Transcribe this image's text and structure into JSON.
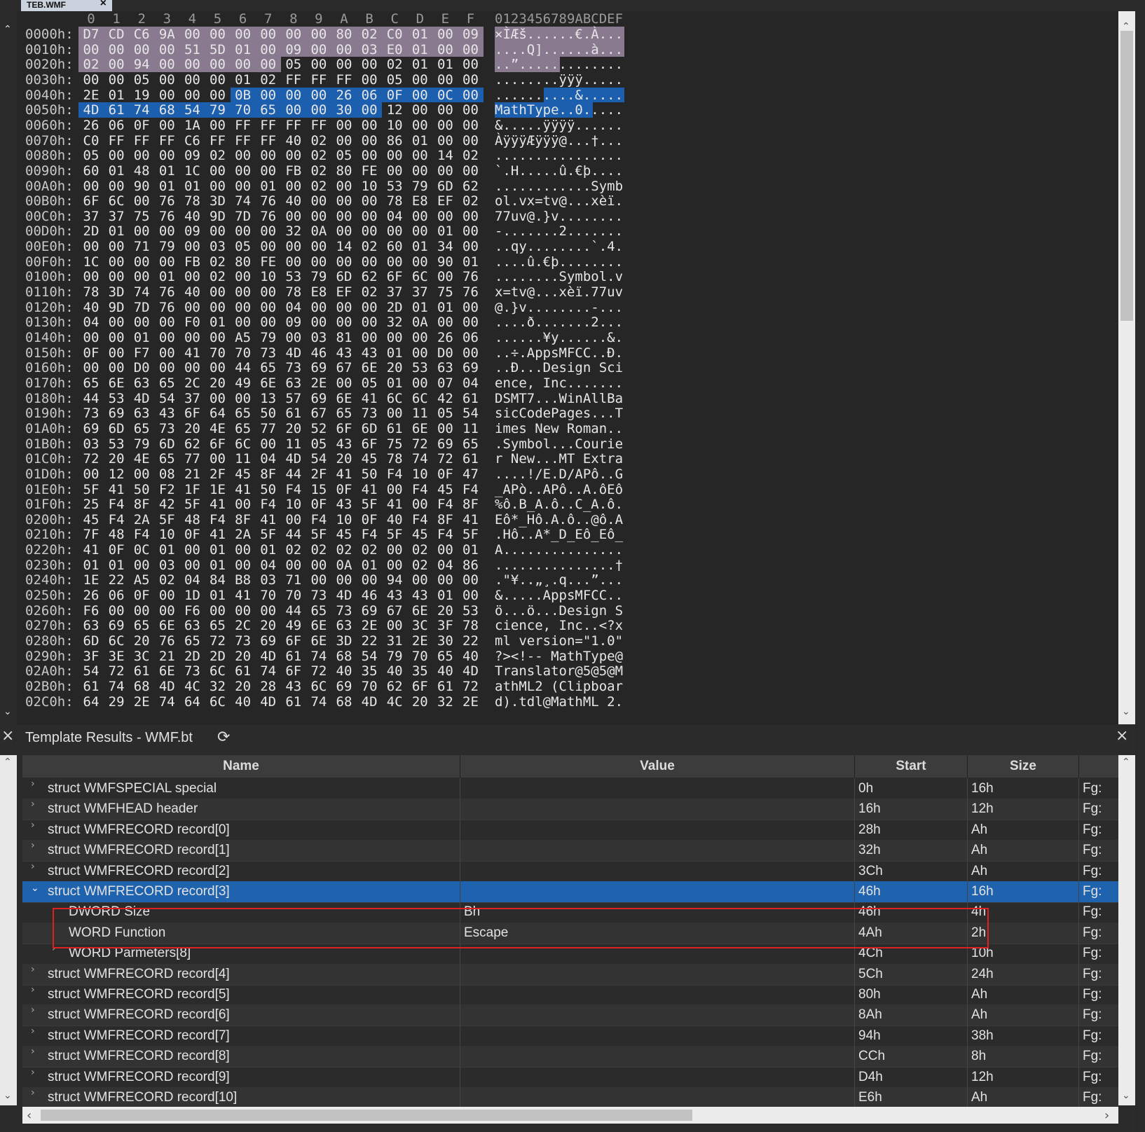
{
  "tab": {
    "title": "TEB.WMF",
    "close": "×"
  },
  "hex_header": {
    "cols": [
      "0",
      "1",
      "2",
      "3",
      "4",
      "5",
      "6",
      "7",
      "8",
      "9",
      "A",
      "B",
      "C",
      "D",
      "E",
      "F"
    ],
    "ascii": "0123456789ABCDEF"
  },
  "hex_rows": [
    {
      "addr": "0000h:",
      "bytes": [
        "D7",
        "CD",
        "C6",
        "9A",
        "00",
        "00",
        "00",
        "00",
        "00",
        "00",
        "80",
        "02",
        "C0",
        "01",
        "00",
        "09"
      ],
      "ascii": "×ÌÆš......€.À..."
    },
    {
      "addr": "0010h:",
      "bytes": [
        "00",
        "00",
        "00",
        "00",
        "51",
        "5D",
        "01",
        "00",
        "09",
        "00",
        "00",
        "03",
        "E0",
        "01",
        "00",
        "00"
      ],
      "ascii": "....Q]......à..."
    },
    {
      "addr": "0020h:",
      "bytes": [
        "02",
        "00",
        "94",
        "00",
        "00",
        "00",
        "00",
        "00",
        "05",
        "00",
        "00",
        "00",
        "02",
        "01",
        "01",
        "00"
      ],
      "ascii": "..”............."
    },
    {
      "addr": "0030h:",
      "bytes": [
        "00",
        "00",
        "05",
        "00",
        "00",
        "00",
        "01",
        "02",
        "FF",
        "FF",
        "FF",
        "00",
        "05",
        "00",
        "00",
        "00"
      ],
      "ascii": "........ÿÿÿ....."
    },
    {
      "addr": "0040h:",
      "bytes": [
        "2E",
        "01",
        "19",
        "00",
        "00",
        "00",
        "0B",
        "00",
        "00",
        "00",
        "26",
        "06",
        "0F",
        "00",
        "0C",
        "00"
      ],
      "ascii": "..........&....."
    },
    {
      "addr": "0050h:",
      "bytes": [
        "4D",
        "61",
        "74",
        "68",
        "54",
        "79",
        "70",
        "65",
        "00",
        "00",
        "30",
        "00",
        "12",
        "00",
        "00",
        "00"
      ],
      "ascii": "MathType..0....."
    },
    {
      "addr": "0060h:",
      "bytes": [
        "26",
        "06",
        "0F",
        "00",
        "1A",
        "00",
        "FF",
        "FF",
        "FF",
        "FF",
        "00",
        "00",
        "10",
        "00",
        "00",
        "00"
      ],
      "ascii": "&.....ÿÿÿÿ......"
    },
    {
      "addr": "0070h:",
      "bytes": [
        "C0",
        "FF",
        "FF",
        "FF",
        "C6",
        "FF",
        "FF",
        "FF",
        "40",
        "02",
        "00",
        "00",
        "86",
        "01",
        "00",
        "00"
      ],
      "ascii": "ÀÿÿÿÆÿÿÿ@...†..."
    },
    {
      "addr": "0080h:",
      "bytes": [
        "05",
        "00",
        "00",
        "00",
        "09",
        "02",
        "00",
        "00",
        "00",
        "02",
        "05",
        "00",
        "00",
        "00",
        "14",
        "02"
      ],
      "ascii": "................"
    },
    {
      "addr": "0090h:",
      "bytes": [
        "60",
        "01",
        "48",
        "01",
        "1C",
        "00",
        "00",
        "00",
        "FB",
        "02",
        "80",
        "FE",
        "00",
        "00",
        "00",
        "00"
      ],
      "ascii": "`.H.....û.€þ...."
    },
    {
      "addr": "00A0h:",
      "bytes": [
        "00",
        "00",
        "90",
        "01",
        "01",
        "00",
        "00",
        "01",
        "00",
        "02",
        "00",
        "10",
        "53",
        "79",
        "6D",
        "62"
      ],
      "ascii": "............Symb"
    },
    {
      "addr": "00B0h:",
      "bytes": [
        "6F",
        "6C",
        "00",
        "76",
        "78",
        "3D",
        "74",
        "76",
        "40",
        "00",
        "00",
        "00",
        "78",
        "E8",
        "EF",
        "02"
      ],
      "ascii": "ol.vx=tv@...xèï."
    },
    {
      "addr": "00C0h:",
      "bytes": [
        "37",
        "37",
        "75",
        "76",
        "40",
        "9D",
        "7D",
        "76",
        "00",
        "00",
        "00",
        "00",
        "04",
        "00",
        "00",
        "00"
      ],
      "ascii": "77uv@.}v........"
    },
    {
      "addr": "00D0h:",
      "bytes": [
        "2D",
        "01",
        "00",
        "00",
        "09",
        "00",
        "00",
        "00",
        "32",
        "0A",
        "00",
        "00",
        "00",
        "00",
        "01",
        "00"
      ],
      "ascii": "-.......2......."
    },
    {
      "addr": "00E0h:",
      "bytes": [
        "00",
        "00",
        "71",
        "79",
        "00",
        "03",
        "05",
        "00",
        "00",
        "00",
        "14",
        "02",
        "60",
        "01",
        "34",
        "00"
      ],
      "ascii": "..qy........`.4."
    },
    {
      "addr": "00F0h:",
      "bytes": [
        "1C",
        "00",
        "00",
        "00",
        "FB",
        "02",
        "80",
        "FE",
        "00",
        "00",
        "00",
        "00",
        "00",
        "00",
        "90",
        "01"
      ],
      "ascii": "....û.€þ........"
    },
    {
      "addr": "0100h:",
      "bytes": [
        "00",
        "00",
        "00",
        "01",
        "00",
        "02",
        "00",
        "10",
        "53",
        "79",
        "6D",
        "62",
        "6F",
        "6C",
        "00",
        "76"
      ],
      "ascii": "........Symbol.v"
    },
    {
      "addr": "0110h:",
      "bytes": [
        "78",
        "3D",
        "74",
        "76",
        "40",
        "00",
        "00",
        "00",
        "78",
        "E8",
        "EF",
        "02",
        "37",
        "37",
        "75",
        "76"
      ],
      "ascii": "x=tv@...xèï.77uv"
    },
    {
      "addr": "0120h:",
      "bytes": [
        "40",
        "9D",
        "7D",
        "76",
        "00",
        "00",
        "00",
        "00",
        "04",
        "00",
        "00",
        "00",
        "2D",
        "01",
        "01",
        "00"
      ],
      "ascii": "@.}v........-..."
    },
    {
      "addr": "0130h:",
      "bytes": [
        "04",
        "00",
        "00",
        "00",
        "F0",
        "01",
        "00",
        "00",
        "09",
        "00",
        "00",
        "00",
        "32",
        "0A",
        "00",
        "00"
      ],
      "ascii": "....ð.......2..."
    },
    {
      "addr": "0140h:",
      "bytes": [
        "00",
        "00",
        "01",
        "00",
        "00",
        "00",
        "A5",
        "79",
        "00",
        "03",
        "81",
        "00",
        "00",
        "00",
        "26",
        "06"
      ],
      "ascii": "......¥y......&."
    },
    {
      "addr": "0150h:",
      "bytes": [
        "0F",
        "00",
        "F7",
        "00",
        "41",
        "70",
        "70",
        "73",
        "4D",
        "46",
        "43",
        "43",
        "01",
        "00",
        "D0",
        "00"
      ],
      "ascii": "..÷.AppsMFCC..Ð."
    },
    {
      "addr": "0160h:",
      "bytes": [
        "00",
        "00",
        "D0",
        "00",
        "00",
        "00",
        "44",
        "65",
        "73",
        "69",
        "67",
        "6E",
        "20",
        "53",
        "63",
        "69"
      ],
      "ascii": "..Ð...Design Sci"
    },
    {
      "addr": "0170h:",
      "bytes": [
        "65",
        "6E",
        "63",
        "65",
        "2C",
        "20",
        "49",
        "6E",
        "63",
        "2E",
        "00",
        "05",
        "01",
        "00",
        "07",
        "04"
      ],
      "ascii": "ence, Inc......."
    },
    {
      "addr": "0180h:",
      "bytes": [
        "44",
        "53",
        "4D",
        "54",
        "37",
        "00",
        "00",
        "13",
        "57",
        "69",
        "6E",
        "41",
        "6C",
        "6C",
        "42",
        "61"
      ],
      "ascii": "DSMT7...WinAllBa"
    },
    {
      "addr": "0190h:",
      "bytes": [
        "73",
        "69",
        "63",
        "43",
        "6F",
        "64",
        "65",
        "50",
        "61",
        "67",
        "65",
        "73",
        "00",
        "11",
        "05",
        "54"
      ],
      "ascii": "sicCodePages...T"
    },
    {
      "addr": "01A0h:",
      "bytes": [
        "69",
        "6D",
        "65",
        "73",
        "20",
        "4E",
        "65",
        "77",
        "20",
        "52",
        "6F",
        "6D",
        "61",
        "6E",
        "00",
        "11"
      ],
      "ascii": "imes New Roman.."
    },
    {
      "addr": "01B0h:",
      "bytes": [
        "03",
        "53",
        "79",
        "6D",
        "62",
        "6F",
        "6C",
        "00",
        "11",
        "05",
        "43",
        "6F",
        "75",
        "72",
        "69",
        "65"
      ],
      "ascii": ".Symbol...Courie"
    },
    {
      "addr": "01C0h:",
      "bytes": [
        "72",
        "20",
        "4E",
        "65",
        "77",
        "00",
        "11",
        "04",
        "4D",
        "54",
        "20",
        "45",
        "78",
        "74",
        "72",
        "61"
      ],
      "ascii": "r New...MT Extra"
    },
    {
      "addr": "01D0h:",
      "bytes": [
        "00",
        "12",
        "00",
        "08",
        "21",
        "2F",
        "45",
        "8F",
        "44",
        "2F",
        "41",
        "50",
        "F4",
        "10",
        "0F",
        "47"
      ],
      "ascii": "....!/E.D/APô..G"
    },
    {
      "addr": "01E0h:",
      "bytes": [
        "5F",
        "41",
        "50",
        "F2",
        "1F",
        "1E",
        "41",
        "50",
        "F4",
        "15",
        "0F",
        "41",
        "00",
        "F4",
        "45",
        "F4"
      ],
      "ascii": "_APò..APô..A.ôEô"
    },
    {
      "addr": "01F0h:",
      "bytes": [
        "25",
        "F4",
        "8F",
        "42",
        "5F",
        "41",
        "00",
        "F4",
        "10",
        "0F",
        "43",
        "5F",
        "41",
        "00",
        "F4",
        "8F"
      ],
      "ascii": "%ô.B_A.ô..C_A.ô."
    },
    {
      "addr": "0200h:",
      "bytes": [
        "45",
        "F4",
        "2A",
        "5F",
        "48",
        "F4",
        "8F",
        "41",
        "00",
        "F4",
        "10",
        "0F",
        "40",
        "F4",
        "8F",
        "41"
      ],
      "ascii": "Eô*_Hô.A.ô..@ô.A"
    },
    {
      "addr": "0210h:",
      "bytes": [
        "7F",
        "48",
        "F4",
        "10",
        "0F",
        "41",
        "2A",
        "5F",
        "44",
        "5F",
        "45",
        "F4",
        "5F",
        "45",
        "F4",
        "5F"
      ],
      "ascii": ".Hô..A*_D_Eô_Eô_"
    },
    {
      "addr": "0220h:",
      "bytes": [
        "41",
        "0F",
        "0C",
        "01",
        "00",
        "01",
        "00",
        "01",
        "02",
        "02",
        "02",
        "02",
        "00",
        "02",
        "00",
        "01"
      ],
      "ascii": "A..............."
    },
    {
      "addr": "0230h:",
      "bytes": [
        "01",
        "01",
        "00",
        "03",
        "00",
        "01",
        "00",
        "04",
        "00",
        "00",
        "0A",
        "01",
        "00",
        "02",
        "04",
        "86"
      ],
      "ascii": "...............†"
    },
    {
      "addr": "0240h:",
      "bytes": [
        "1E",
        "22",
        "A5",
        "02",
        "04",
        "84",
        "B8",
        "03",
        "71",
        "00",
        "00",
        "00",
        "94",
        "00",
        "00",
        "00"
      ],
      "ascii": ".\"¥..„¸.q...”..."
    },
    {
      "addr": "0250h:",
      "bytes": [
        "26",
        "06",
        "0F",
        "00",
        "1D",
        "01",
        "41",
        "70",
        "70",
        "73",
        "4D",
        "46",
        "43",
        "43",
        "01",
        "00"
      ],
      "ascii": "&.....AppsMFCC.."
    },
    {
      "addr": "0260h:",
      "bytes": [
        "F6",
        "00",
        "00",
        "00",
        "F6",
        "00",
        "00",
        "00",
        "44",
        "65",
        "73",
        "69",
        "67",
        "6E",
        "20",
        "53"
      ],
      "ascii": "ö...ö...Design S"
    },
    {
      "addr": "0270h:",
      "bytes": [
        "63",
        "69",
        "65",
        "6E",
        "63",
        "65",
        "2C",
        "20",
        "49",
        "6E",
        "63",
        "2E",
        "00",
        "3C",
        "3F",
        "78"
      ],
      "ascii": "cience, Inc..<?x"
    },
    {
      "addr": "0280h:",
      "bytes": [
        "6D",
        "6C",
        "20",
        "76",
        "65",
        "72",
        "73",
        "69",
        "6F",
        "6E",
        "3D",
        "22",
        "31",
        "2E",
        "30",
        "22"
      ],
      "ascii": "ml version=\"1.0\""
    },
    {
      "addr": "0290h:",
      "bytes": [
        "3F",
        "3E",
        "3C",
        "21",
        "2D",
        "2D",
        "20",
        "4D",
        "61",
        "74",
        "68",
        "54",
        "79",
        "70",
        "65",
        "40"
      ],
      "ascii": "?><!-- MathType@"
    },
    {
      "addr": "02A0h:",
      "bytes": [
        "54",
        "72",
        "61",
        "6E",
        "73",
        "6C",
        "61",
        "74",
        "6F",
        "72",
        "40",
        "35",
        "40",
        "35",
        "40",
        "4D"
      ],
      "ascii": "Translator@5@5@M"
    },
    {
      "addr": "02B0h:",
      "bytes": [
        "61",
        "74",
        "68",
        "4D",
        "4C",
        "32",
        "20",
        "28",
        "43",
        "6C",
        "69",
        "70",
        "62",
        "6F",
        "61",
        "72"
      ],
      "ascii": "athML2 (Clipboar"
    },
    {
      "addr": "02C0h:",
      "bytes": [
        "64",
        "29",
        "2E",
        "74",
        "64",
        "6C",
        "40",
        "4D",
        "61",
        "74",
        "68",
        "4D",
        "4C",
        "20",
        "32",
        "2E"
      ],
      "ascii": "d).tdl@MathML 2."
    }
  ],
  "panel": {
    "title": "Template Results - WMF.bt",
    "refresh_icon": "⟳",
    "close": "×"
  },
  "columns": {
    "name": "Name",
    "value": "Value",
    "start": "Start",
    "size": "Size",
    "color": "Fg:"
  },
  "results": [
    {
      "name": "struct WMFSPECIAL special",
      "value": "",
      "start": "0h",
      "size": "16h",
      "color": "Fg:",
      "level": 0,
      "state": "collapsed"
    },
    {
      "name": "struct WMFHEAD header",
      "value": "",
      "start": "16h",
      "size": "12h",
      "color": "Fg:",
      "level": 0,
      "state": "collapsed"
    },
    {
      "name": "struct WMFRECORD record[0]",
      "value": "",
      "start": "28h",
      "size": "Ah",
      "color": "Fg:",
      "level": 0,
      "state": "collapsed"
    },
    {
      "name": "struct WMFRECORD record[1]",
      "value": "",
      "start": "32h",
      "size": "Ah",
      "color": "Fg:",
      "level": 0,
      "state": "collapsed"
    },
    {
      "name": "struct WMFRECORD record[2]",
      "value": "",
      "start": "3Ch",
      "size": "Ah",
      "color": "Fg:",
      "level": 0,
      "state": "collapsed"
    },
    {
      "name": "struct WMFRECORD record[3]",
      "value": "",
      "start": "46h",
      "size": "16h",
      "color": "Fg:",
      "level": 0,
      "state": "expanded"
    },
    {
      "name": "DWORD Size",
      "value": "Bh",
      "start": "46h",
      "size": "4h",
      "color": "Fg:",
      "level": 1,
      "state": "leaf"
    },
    {
      "name": "WORD Function",
      "value": "Escape",
      "start": "4Ah",
      "size": "2h",
      "color": "Fg:",
      "level": 1,
      "state": "leaf"
    },
    {
      "name": "WORD Parmeters[8]",
      "value": "",
      "start": "4Ch",
      "size": "10h",
      "color": "Fg:",
      "level": 1,
      "state": "collapsed"
    },
    {
      "name": "struct WMFRECORD record[4]",
      "value": "",
      "start": "5Ch",
      "size": "24h",
      "color": "Fg:",
      "level": 0,
      "state": "collapsed"
    },
    {
      "name": "struct WMFRECORD record[5]",
      "value": "",
      "start": "80h",
      "size": "Ah",
      "color": "Fg:",
      "level": 0,
      "state": "collapsed"
    },
    {
      "name": "struct WMFRECORD record[6]",
      "value": "",
      "start": "8Ah",
      "size": "Ah",
      "color": "Fg:",
      "level": 0,
      "state": "collapsed"
    },
    {
      "name": "struct WMFRECORD record[7]",
      "value": "",
      "start": "94h",
      "size": "38h",
      "color": "Fg:",
      "level": 0,
      "state": "collapsed"
    },
    {
      "name": "struct WMFRECORD record[8]",
      "value": "",
      "start": "CCh",
      "size": "8h",
      "color": "Fg:",
      "level": 0,
      "state": "collapsed"
    },
    {
      "name": "struct WMFRECORD record[9]",
      "value": "",
      "start": "D4h",
      "size": "12h",
      "color": "Fg:",
      "level": 0,
      "state": "collapsed"
    },
    {
      "name": "struct WMFRECORD record[10]",
      "value": "",
      "start": "E6h",
      "size": "Ah",
      "color": "Fg:",
      "level": 0,
      "state": "collapsed"
    }
  ],
  "icons": {
    "expand": "›",
    "collapse": "⌄",
    "scroll_up": "⌃",
    "scroll_down": "⌄",
    "scroll_left": "‹",
    "scroll_right": "›"
  },
  "colors": {
    "selection": "#1c5fae",
    "header_highlight": "#8a7a90",
    "highlight_box": "#e02020"
  }
}
